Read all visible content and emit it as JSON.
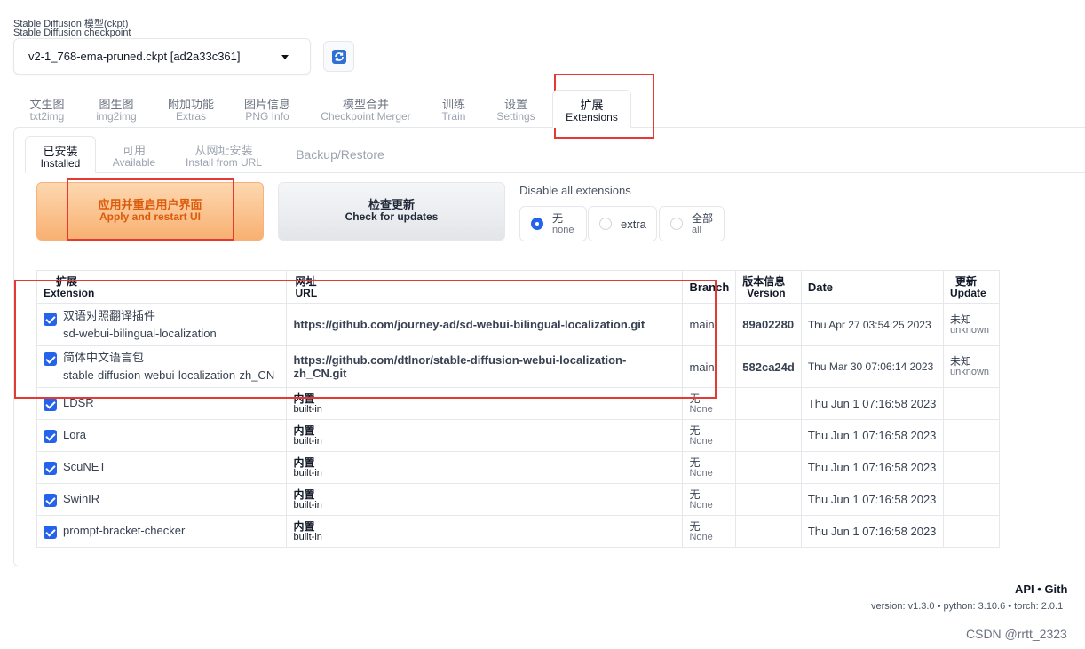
{
  "checkpoint": {
    "label_cn": "Stable Diffusion 模型(ckpt)",
    "label_en": "Stable Diffusion checkpoint",
    "value": "v2-1_768-ema-pruned.ckpt [ad2a33c361]"
  },
  "main_tabs": [
    {
      "cn": "文生图",
      "en": "txt2img"
    },
    {
      "cn": "图生图",
      "en": "img2img"
    },
    {
      "cn": "附加功能",
      "en": "Extras"
    },
    {
      "cn": "图片信息",
      "en": "PNG Info"
    },
    {
      "cn": "模型合并",
      "en": "Checkpoint Merger"
    },
    {
      "cn": "训练",
      "en": "Train"
    },
    {
      "cn": "设置",
      "en": "Settings"
    },
    {
      "cn": "扩展",
      "en": "Extensions"
    }
  ],
  "sub_tabs": [
    {
      "cn": "已安装",
      "en": "Installed"
    },
    {
      "cn": "可用",
      "en": "Available"
    },
    {
      "cn": "从网址安装",
      "en": "Install from URL"
    },
    {
      "cn": "Backup/Restore",
      "en": ""
    }
  ],
  "buttons": {
    "apply_cn": "应用并重启用户界面",
    "apply_en": "Apply and restart UI",
    "check_cn": "检查更新",
    "check_en": "Check for updates"
  },
  "disable": {
    "label": "Disable all extensions",
    "options": [
      {
        "cn": "无",
        "en": "none",
        "selected": true
      },
      {
        "cn": "extra",
        "en": "",
        "selected": false
      },
      {
        "cn": "全部",
        "en": "all",
        "selected": false
      }
    ]
  },
  "table": {
    "headers": [
      {
        "cn": "扩展",
        "en": "Extension"
      },
      {
        "cn": "网址",
        "en": "URL"
      },
      {
        "cn": "Branch",
        "en": ""
      },
      {
        "cn": "版本信息",
        "en": "Version"
      },
      {
        "cn": "Date",
        "en": ""
      },
      {
        "cn": "更新",
        "en": "Update"
      }
    ],
    "rows": [
      {
        "name_cn": "双语对照翻译插件",
        "name": "sd-webui-bilingual-localization",
        "url": "https://github.com/journey-ad/sd-webui-bilingual-localization.git",
        "branch": "main",
        "branch_en": "",
        "version": "89a02280",
        "date": "Thu Apr 27 03:54:25 2023",
        "update_cn": "未知",
        "update_en": "unknown"
      },
      {
        "name_cn": "简体中文语言包",
        "name": "stable-diffusion-webui-localization-zh_CN",
        "url": "https://github.com/dtlnor/stable-diffusion-webui-localization-zh_CN.git",
        "branch": "main",
        "branch_en": "",
        "version": "582ca24d",
        "date": "Thu Mar 30 07:06:14 2023",
        "update_cn": "未知",
        "update_en": "unknown"
      },
      {
        "name": "LDSR",
        "url_cn": "内置",
        "url_en": "built-in",
        "branch": "无",
        "branch_en": "None",
        "version": "",
        "date": "Thu Jun 1 07:16:58 2023"
      },
      {
        "name": "Lora",
        "url_cn": "内置",
        "url_en": "built-in",
        "branch": "无",
        "branch_en": "None",
        "version": "",
        "date": "Thu Jun 1 07:16:58 2023"
      },
      {
        "name": "ScuNET",
        "url_cn": "内置",
        "url_en": "built-in",
        "branch": "无",
        "branch_en": "None",
        "version": "",
        "date": "Thu Jun 1 07:16:58 2023"
      },
      {
        "name": "SwinIR",
        "url_cn": "内置",
        "url_en": "built-in",
        "branch": "无",
        "branch_en": "None",
        "version": "",
        "date": "Thu Jun 1 07:16:58 2023"
      },
      {
        "name": "prompt-bracket-checker",
        "url_cn": "内置",
        "url_en": "built-in",
        "branch": "无",
        "branch_en": "None",
        "version": "",
        "date": "Thu Jun 1 07:16:58 2023"
      }
    ]
  },
  "footer": {
    "links": "API  •  Gith",
    "version": "version: v1.3.0  •  python: 3.10.6  •  torch: 2.0.1"
  },
  "watermark": "CSDN @rrtt_2323",
  "colors": {
    "accent": "#2563eb",
    "highlight": "#e53935",
    "apply": "#dc5a0c"
  }
}
